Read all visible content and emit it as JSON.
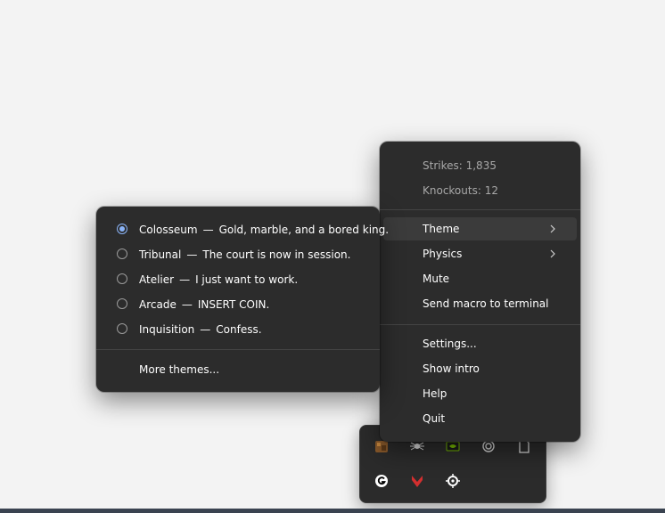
{
  "main_menu": {
    "stats": [
      {
        "label": "Strikes: 1,835"
      },
      {
        "label": "Knockouts: 12"
      }
    ],
    "theme_label": "Theme",
    "physics_label": "Physics",
    "mute_label": "Mute",
    "send_macro_label": "Send macro to terminal",
    "settings_label": "Settings...",
    "show_intro_label": "Show intro",
    "help_label": "Help",
    "quit_label": "Quit"
  },
  "theme_menu": {
    "selected": "Colosseum",
    "separator": "—",
    "items": [
      {
        "name": "Colosseum",
        "tagline": "Gold, marble, and a bored king."
      },
      {
        "name": "Tribunal",
        "tagline": "The court is now in session."
      },
      {
        "name": "Atelier",
        "tagline": "I just want to work."
      },
      {
        "name": "Arcade",
        "tagline": "INSERT COIN."
      },
      {
        "name": "Inquisition",
        "tagline": "Confess."
      }
    ],
    "more_label": "More themes..."
  },
  "tray": {
    "icons": [
      "folder-app-icon",
      "spider-icon",
      "nvidia-icon",
      "swirl-icon",
      "document-icon",
      "logitech-g-icon",
      "red-chevron-icon",
      "steelseries-icon"
    ]
  },
  "colors": {
    "menu_bg": "#2c2c2c",
    "hover_bg": "#3b3b3b",
    "radio_accent": "#8ab4f8",
    "desktop_bg": "#f3f3f3"
  }
}
